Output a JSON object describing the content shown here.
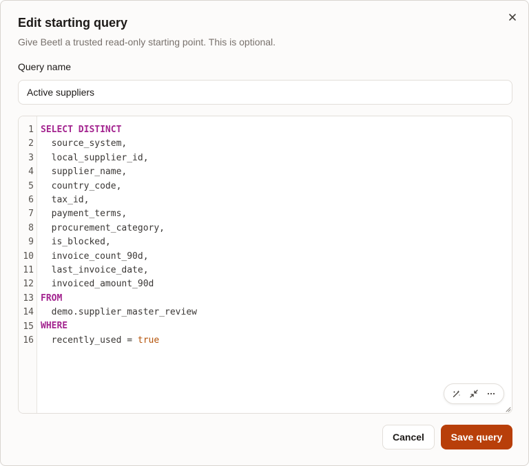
{
  "dialog": {
    "title": "Edit starting query",
    "subtitle": "Give Beetl a trusted read-only starting point. This is optional.",
    "close_icon": "close-icon"
  },
  "query_name": {
    "label": "Query name",
    "value": "Active suppliers"
  },
  "editor": {
    "line_numbers": [
      "1",
      "2",
      "3",
      "4",
      "5",
      "6",
      "7",
      "8",
      "9",
      "10",
      "11",
      "12",
      "13",
      "14",
      "15",
      "16"
    ],
    "lines": [
      [
        {
          "t": "SELECT DISTINCT",
          "k": "keyword"
        }
      ],
      [
        {
          "t": "  source_system,",
          "k": "ident"
        }
      ],
      [
        {
          "t": "  local_supplier_id,",
          "k": "ident"
        }
      ],
      [
        {
          "t": "  supplier_name,",
          "k": "ident"
        }
      ],
      [
        {
          "t": "  country_code,",
          "k": "ident"
        }
      ],
      [
        {
          "t": "  tax_id,",
          "k": "ident"
        }
      ],
      [
        {
          "t": "  payment_terms,",
          "k": "ident"
        }
      ],
      [
        {
          "t": "  procurement_category,",
          "k": "ident"
        }
      ],
      [
        {
          "t": "  is_blocked,",
          "k": "ident"
        }
      ],
      [
        {
          "t": "  invoice_count_90d,",
          "k": "ident"
        }
      ],
      [
        {
          "t": "  last_invoice_date,",
          "k": "ident"
        }
      ],
      [
        {
          "t": "  invoiced_amount_90d",
          "k": "ident"
        }
      ],
      [
        {
          "t": "FROM",
          "k": "keyword"
        }
      ],
      [
        {
          "t": "  demo.supplier_master_review",
          "k": "ident"
        }
      ],
      [
        {
          "t": "WHERE",
          "k": "keyword"
        }
      ],
      [
        {
          "t": "  recently_used = ",
          "k": "ident"
        },
        {
          "t": "true",
          "k": "bool"
        }
      ]
    ],
    "toolbar_icons": [
      "magic-wand-icon",
      "collapse-icon",
      "more-icon"
    ]
  },
  "actions": {
    "cancel_label": "Cancel",
    "save_label": "Save query"
  },
  "colors": {
    "accent": "#b83f0a",
    "keyword": "#a3248f",
    "boolean": "#b45309"
  }
}
